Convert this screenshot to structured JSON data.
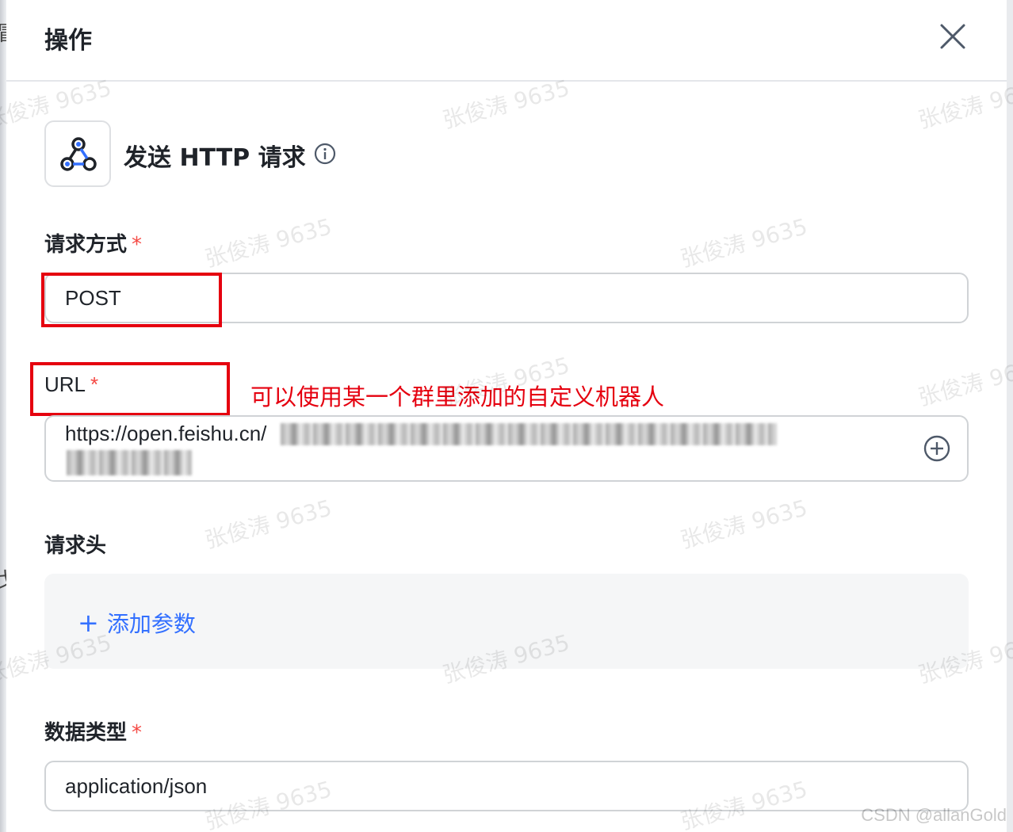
{
  "header": {
    "title": "操作"
  },
  "action": {
    "title": "发送 HTTP 请求",
    "icon": "webhook-icon"
  },
  "method_field": {
    "label": "请求方式",
    "required_mark": "*",
    "value": "POST"
  },
  "url_field": {
    "label": "URL",
    "required_mark": "*",
    "value": "https://open.feishu.cn/",
    "annotation": "可以使用某一个群里添加的自定义机器人"
  },
  "headers_field": {
    "label": "请求头",
    "add_label": "添加参数",
    "add_icon": "+"
  },
  "data_type_field": {
    "label": "数据类型",
    "required_mark": "*",
    "value": "application/json"
  },
  "watermark_text": "张俊涛 9635",
  "credit": "CSDN @allanGold",
  "colors": {
    "accent": "#3370ff",
    "required": "#f54a45",
    "annotation": "#e5000f"
  }
}
